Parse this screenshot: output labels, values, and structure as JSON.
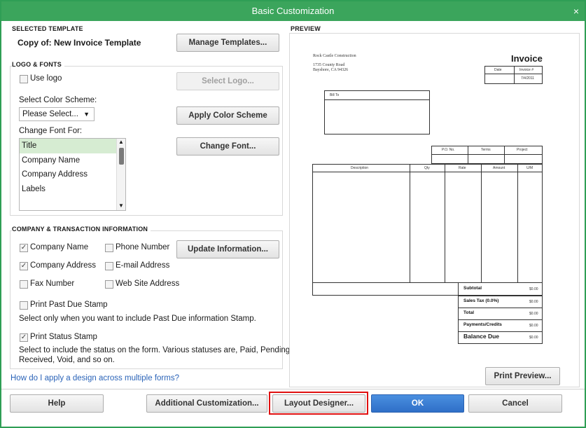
{
  "window": {
    "title": "Basic Customization",
    "close_symbol": "×"
  },
  "selected_template": {
    "section_title": "SELECTED TEMPLATE",
    "name": "Copy of: New Invoice Template",
    "manage_button": "Manage Templates..."
  },
  "logo_fonts": {
    "section_title": "LOGO & FONTS",
    "use_logo_label": "Use logo",
    "use_logo_checked": false,
    "select_logo_button": "Select Logo...",
    "color_scheme_label": "Select Color Scheme:",
    "color_scheme_value": "Please Select...",
    "apply_color_button": "Apply Color Scheme",
    "change_font_label": "Change Font For:",
    "font_items": [
      "Title",
      "Company Name",
      "Company Address",
      "Labels"
    ],
    "selected_font_item": "Title",
    "change_font_button": "Change Font..."
  },
  "company_info": {
    "section_title": "COMPANY & TRANSACTION INFORMATION",
    "company_name": {
      "label": "Company Name",
      "checked": true
    },
    "phone_number": {
      "label": "Phone Number",
      "checked": false
    },
    "company_address": {
      "label": "Company Address",
      "checked": true
    },
    "email_address": {
      "label": "E-mail Address",
      "checked": false
    },
    "fax_number": {
      "label": "Fax Number",
      "checked": false
    },
    "web_site": {
      "label": "Web Site Address",
      "checked": false
    },
    "update_button": "Update Information...",
    "past_due_label": "Print Past Due Stamp",
    "past_due_checked": false,
    "past_due_note": "Select only when you want to include Past Due information Stamp.",
    "status_stamp_label": "Print Status Stamp",
    "status_stamp_checked": true,
    "status_note_line1": "Select to include the status on the form. Various statuses are, Paid, Pending,",
    "status_note_line2": "Received, Void, and so on."
  },
  "help_link": "How do I apply a design across multiple forms?",
  "preview": {
    "section_title": "PREVIEW",
    "company": "Rock Castle Construction",
    "address1": "1735 County Road",
    "address2": "Bayshore, CA 94326",
    "doc_title": "Invoice",
    "date_header": "Date",
    "invoice_no_header": "Invoice #",
    "date_value": "7/4/2011",
    "bill_to": "Bill To",
    "po_no": "P.O. No.",
    "terms": "Terms",
    "project": "Project",
    "col_description": "Description",
    "col_qty": "Qty",
    "col_rate": "Rate",
    "col_amount": "Amount",
    "col_um": "U/M",
    "subtotal": "Subtotal",
    "sales_tax": "Sales Tax  (0.0%)",
    "total": "Total",
    "payments": "Payments/Credits",
    "balance_due": "Balance Due",
    "zero": "$0.00",
    "print_preview_button": "Print Preview..."
  },
  "footer": {
    "help": "Help",
    "additional": "Additional Customization...",
    "layout": "Layout Designer...",
    "ok": "OK",
    "cancel": "Cancel"
  },
  "colors": {
    "title_bar": "#3ba55c",
    "highlight": "#e01010",
    "primary_button": "#2f6fc8"
  }
}
